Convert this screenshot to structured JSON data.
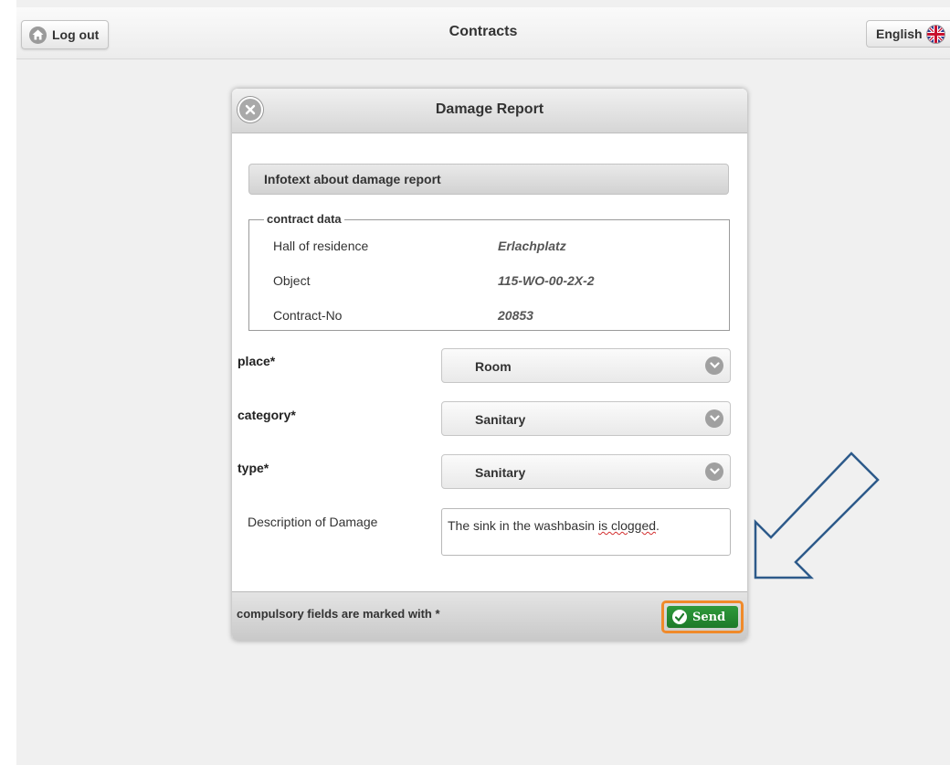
{
  "header": {
    "logout_label": "Log out",
    "title": "Contracts",
    "language_label": "English",
    "icons": {
      "home": "home-icon",
      "flag": "uk-flag-icon"
    }
  },
  "dialog": {
    "title": "Damage Report",
    "close_icon": "close-icon",
    "infotext": "Infotext about damage report",
    "contract_data": {
      "legend": "contract data",
      "rows": [
        {
          "label": "Hall of residence",
          "value": "Erlachplatz"
        },
        {
          "label": "Object",
          "value": "115-WO-00-2X-2"
        },
        {
          "label": "Contract-No",
          "value": "20853"
        }
      ]
    },
    "fields": {
      "place": {
        "label": "place*",
        "value": "Room"
      },
      "category": {
        "label": "category*",
        "value": "Sanitary"
      },
      "type": {
        "label": "type*",
        "value": "Sanitary"
      },
      "description": {
        "label": "Description of Damage",
        "value_plain": "The sink in the washbasin ",
        "value_marked": "is clogged",
        "value_end": "."
      }
    },
    "footer": {
      "note": "compulsory fields are marked with *",
      "send_label": "Send"
    }
  },
  "colors": {
    "send_button": "#1e7a2a",
    "highlight_border": "#f08a2a",
    "arrow": "#2d5a8a"
  }
}
